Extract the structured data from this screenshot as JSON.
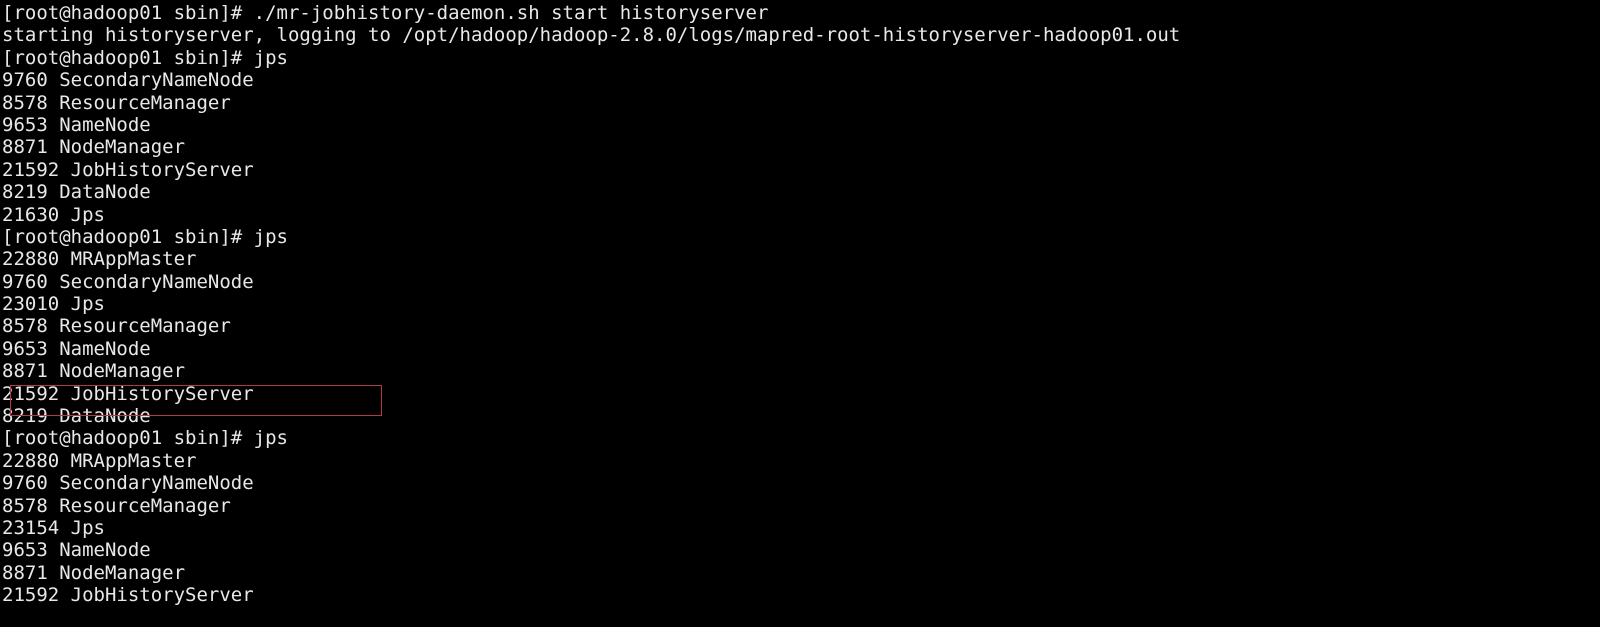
{
  "terminal": {
    "background_color": "#000000",
    "text_color": "#e8e8e8",
    "annotation_color": "#b03a4a",
    "lines": [
      "[root@hadoop01 sbin]# ./mr-jobhistory-daemon.sh start historyserver",
      "starting historyserver, logging to /opt/hadoop/hadoop-2.8.0/logs/mapred-root-historyserver-hadoop01.out",
      "[root@hadoop01 sbin]# jps",
      "9760 SecondaryNameNode",
      "8578 ResourceManager",
      "9653 NameNode",
      "8871 NodeManager",
      "21592 JobHistoryServer",
      "8219 DataNode",
      "21630 Jps",
      "[root@hadoop01 sbin]# jps",
      "22880 MRAppMaster",
      "9760 SecondaryNameNode",
      "23010 Jps",
      "8578 ResourceManager",
      "9653 NameNode",
      "8871 NodeManager",
      "21592 JobHistoryServer",
      "8219 DataNode",
      "[root@hadoop01 sbin]# jps",
      "22880 MRAppMaster",
      "9760 SecondaryNameNode",
      "8578 ResourceManager",
      "23154 Jps",
      "9653 NameNode",
      "8871 NodeManager",
      "21592 JobHistoryServer"
    ],
    "annotation": {
      "label": "highlighted-jobhistoryserver-process",
      "target_line": "21592 JobHistoryServer"
    }
  }
}
